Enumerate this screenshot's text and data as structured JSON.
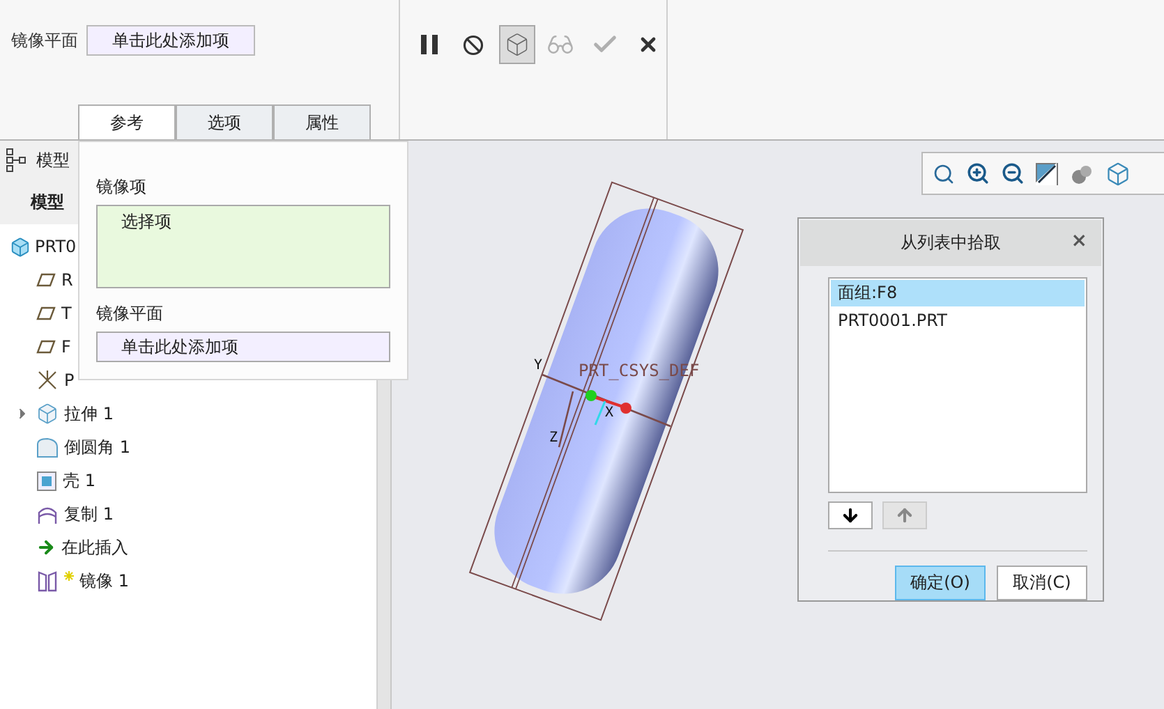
{
  "ribbon": {
    "mirror_plane": {
      "label": "镜像平面",
      "value": "单击此处添加项"
    },
    "tabs": [
      {
        "label": "参考",
        "selected": true
      },
      {
        "label": "选项",
        "selected": false
      },
      {
        "label": "属性",
        "selected": false
      }
    ],
    "tools": [
      {
        "kind": "pause",
        "selected": false,
        "disabled": false
      },
      {
        "kind": "stop",
        "selected": false,
        "disabled": false
      },
      {
        "kind": "preview",
        "selected": true,
        "disabled": false
      },
      {
        "kind": "glasses",
        "selected": false,
        "disabled": true
      },
      {
        "kind": "confirm",
        "selected": false,
        "disabled": true
      },
      {
        "kind": "cancel",
        "selected": false,
        "disabled": false
      }
    ]
  },
  "model_tree": {
    "title": "模型",
    "tab": "模型",
    "items": [
      {
        "label": "PRT0",
        "kind": "part",
        "expandable": false,
        "new": false
      },
      {
        "label": "R",
        "kind": "plane",
        "expandable": false,
        "new": false
      },
      {
        "label": "T",
        "kind": "plane",
        "expandable": false,
        "new": false
      },
      {
        "label": "F",
        "kind": "plane",
        "expandable": false,
        "new": false
      },
      {
        "label": "P",
        "kind": "csys",
        "expandable": false,
        "new": false
      },
      {
        "label": "拉伸 1",
        "kind": "extrude",
        "expandable": true,
        "new": false
      },
      {
        "label": "倒圆角 1",
        "kind": "round",
        "expandable": false,
        "new": false
      },
      {
        "label": "壳 1",
        "kind": "shell",
        "expandable": false,
        "new": false
      },
      {
        "label": "复制 1",
        "kind": "copy",
        "expandable": false,
        "new": false
      },
      {
        "label": "在此插入",
        "kind": "insert",
        "expandable": false,
        "new": false
      },
      {
        "label": "镜像 1",
        "kind": "mirror",
        "expandable": false,
        "new": true
      }
    ]
  },
  "references_panel": {
    "items_label": "镜像项",
    "items_value": "选择项",
    "plane_label": "镜像平面",
    "plane_value": "单击此处添加项"
  },
  "viewport": {
    "csys_label": "PRT_CSYS_DEF",
    "axis_y": "Y",
    "axis_z": "Z",
    "axis_x": "X"
  },
  "pick_dialog": {
    "title": "从列表中拾取",
    "close": "×",
    "items": [
      {
        "label": "面组:F8",
        "selected": true
      },
      {
        "label": "PRT0001.PRT",
        "selected": false
      }
    ],
    "buttons": [
      {
        "label": "确定(O)",
        "primary": true
      },
      {
        "label": "取消(C)",
        "primary": false
      }
    ]
  }
}
